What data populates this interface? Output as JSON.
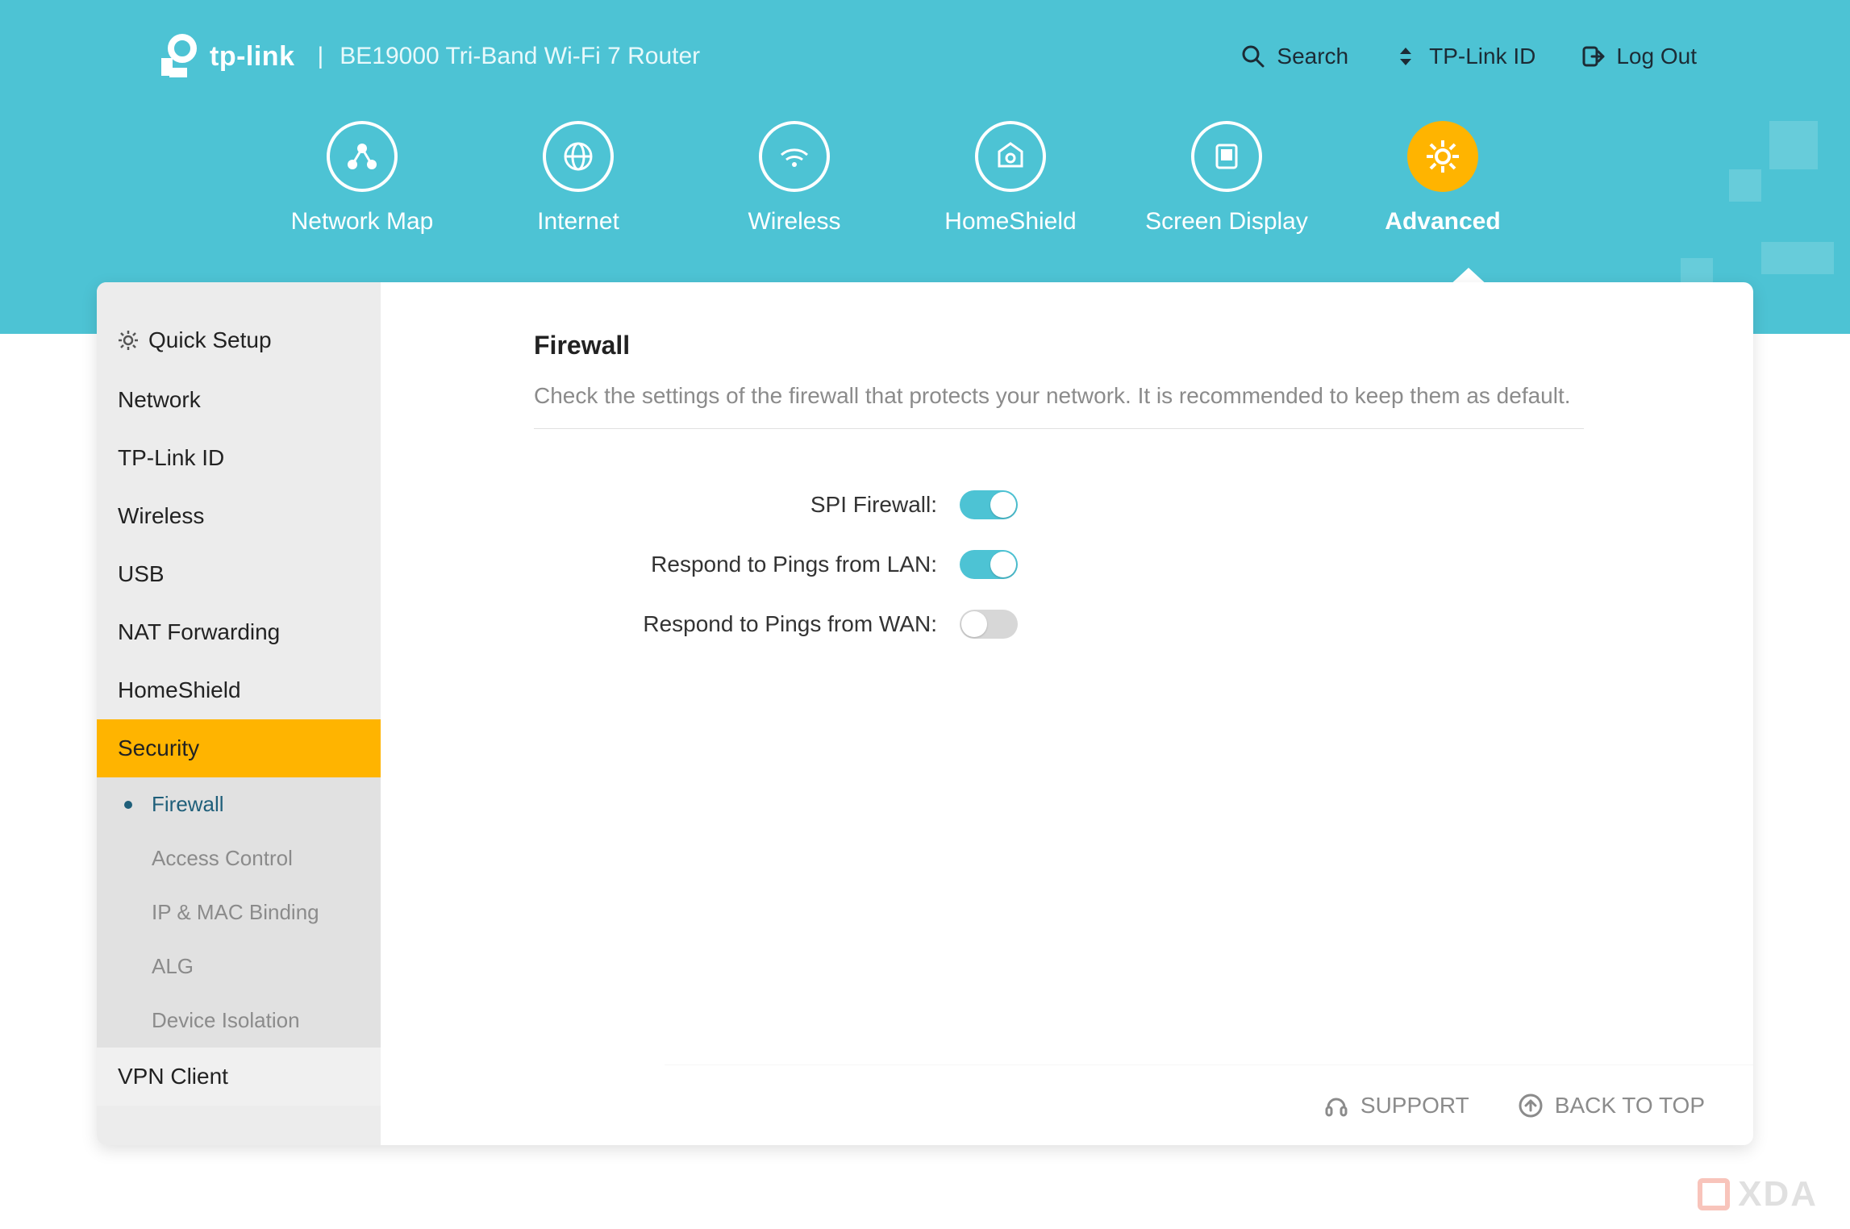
{
  "brand": {
    "name": "tp-link",
    "separator": "|",
    "product": "BE19000 Tri-Band Wi-Fi 7 Router"
  },
  "header_actions": {
    "search": "Search",
    "tplink_id": "TP-Link ID",
    "logout": "Log Out"
  },
  "topnav": [
    {
      "id": "network-map",
      "label": "Network Map"
    },
    {
      "id": "internet",
      "label": "Internet"
    },
    {
      "id": "wireless",
      "label": "Wireless"
    },
    {
      "id": "homeshield",
      "label": "HomeShield"
    },
    {
      "id": "screen-display",
      "label": "Screen Display"
    },
    {
      "id": "advanced",
      "label": "Advanced"
    }
  ],
  "topnav_active": "advanced",
  "sidebar": [
    {
      "id": "quick-setup",
      "label": "Quick Setup",
      "icon": true
    },
    {
      "id": "network",
      "label": "Network"
    },
    {
      "id": "tplink-id",
      "label": "TP-Link ID"
    },
    {
      "id": "wireless",
      "label": "Wireless"
    },
    {
      "id": "usb",
      "label": "USB"
    },
    {
      "id": "nat-forwarding",
      "label": "NAT Forwarding"
    },
    {
      "id": "homeshield",
      "label": "HomeShield"
    },
    {
      "id": "security",
      "label": "Security",
      "active": true
    },
    {
      "id": "vpn-client",
      "label": "VPN Client"
    }
  ],
  "security_sub": [
    {
      "id": "firewall",
      "label": "Firewall",
      "active": true
    },
    {
      "id": "access-control",
      "label": "Access Control"
    },
    {
      "id": "ip-mac-binding",
      "label": "IP & MAC Binding"
    },
    {
      "id": "alg",
      "label": "ALG"
    },
    {
      "id": "device-isolation",
      "label": "Device Isolation"
    }
  ],
  "content": {
    "title": "Firewall",
    "description": "Check the settings of the firewall that protects your network. It is recommended to keep them as default.",
    "settings": [
      {
        "id": "spi-firewall",
        "label": "SPI Firewall:",
        "value": true
      },
      {
        "id": "ping-lan",
        "label": "Respond to Pings from LAN:",
        "value": true
      },
      {
        "id": "ping-wan",
        "label": "Respond to Pings from WAN:",
        "value": false
      }
    ]
  },
  "footer": {
    "support": "SUPPORT",
    "back_to_top": "BACK TO TOP"
  },
  "watermark": "XDA"
}
